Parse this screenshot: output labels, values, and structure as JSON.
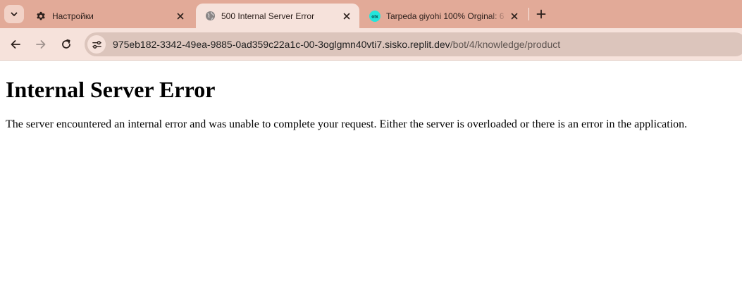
{
  "tabs": [
    {
      "title": "Настройки",
      "icon": "gear-icon",
      "active": false
    },
    {
      "title": "500 Internal Server Error",
      "icon": "globe-icon",
      "active": true
    },
    {
      "title": "Tarpeda giyohi 100% Orginal: 6",
      "icon": "olx-icon",
      "active": false
    }
  ],
  "toolbar": {
    "url_host": "975eb182-3342-49ea-9885-0ad359c22a1c-00-3oglgmn40vti7.sisko.replit.dev",
    "url_path": "/bot/4/knowledge/product"
  },
  "page": {
    "heading": "Internal Server Error",
    "message": "The server encountered an internal error and was unable to complete your request. Either the server is overloaded or there is an error in the application."
  },
  "colors": {
    "tabstrip": "#e2aa98",
    "toolbar": "#f6e2db",
    "omnibox": "#dcc5bc",
    "olx_icon": "#23e5db"
  }
}
